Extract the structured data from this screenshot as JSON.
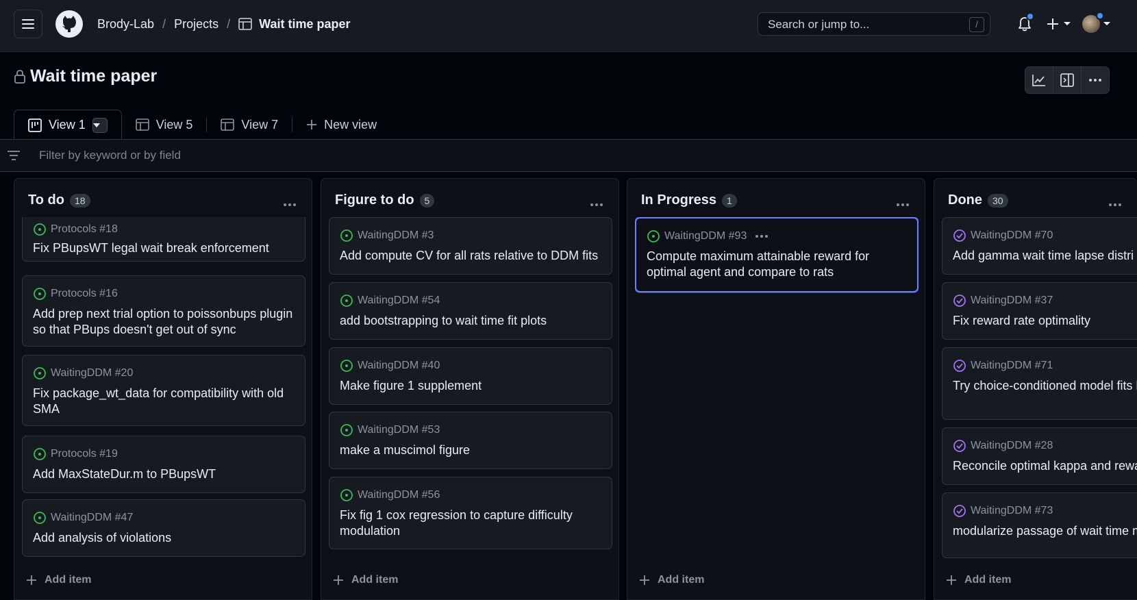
{
  "header": {
    "org": "Brody-Lab",
    "projects": "Projects",
    "project": "Wait time paper",
    "search_placeholder": "Search or jump to...",
    "search_shortcut": "/",
    "icons": [
      "hamburger-icon",
      "github-logo-icon",
      "bell-icon",
      "plus-icon",
      "avatar"
    ]
  },
  "page": {
    "title": "Wait time paper"
  },
  "tabs": [
    {
      "label": "View 1"
    },
    {
      "label": "View 5"
    },
    {
      "label": "View 7"
    },
    {
      "label": "New view"
    }
  ],
  "filter": {
    "placeholder": "Filter by keyword or by field"
  },
  "columns": [
    {
      "name": "To do",
      "count": "18",
      "add_label": "Add item",
      "cards": [
        {
          "meta": "Protocols #18",
          "title": "Fix PBupsWT legal wait break enforcement",
          "state": "open"
        },
        {
          "meta": "Protocols #16",
          "title": "Add prep next trial option to poissonbups plugin so that PBups doesn't get out of sync",
          "state": "open"
        },
        {
          "meta": "WaitingDDM #20",
          "title": "Fix package_wt_data for compatibility with old SMA",
          "state": "open"
        },
        {
          "meta": "Protocols #19",
          "title": "Add MaxStateDur.m to PBupsWT",
          "state": "open"
        },
        {
          "meta": "WaitingDDM #47",
          "title": "Add analysis of violations",
          "state": "open"
        }
      ]
    },
    {
      "name": "Figure to do",
      "count": "5",
      "add_label": "Add item",
      "cards": [
        {
          "meta": "WaitingDDM #3",
          "title": "Add compute CV for all rats relative to DDM fits",
          "state": "open"
        },
        {
          "meta": "WaitingDDM #54",
          "title": "add bootstrapping to wait time fit plots",
          "state": "open"
        },
        {
          "meta": "WaitingDDM #40",
          "title": "Make figure 1 supplement",
          "state": "open"
        },
        {
          "meta": "WaitingDDM #53",
          "title": "make a muscimol figure",
          "state": "open"
        },
        {
          "meta": "WaitingDDM #56",
          "title": "Fix fig 1 cox regression to capture difficulty modulation",
          "state": "open"
        }
      ]
    },
    {
      "name": "In Progress",
      "count": "1",
      "add_label": "Add item",
      "cards": [
        {
          "meta": "WaitingDDM #93",
          "title": "Compute maximum attainable reward for optimal agent and compare to rats",
          "state": "open"
        }
      ]
    },
    {
      "name": "Done",
      "count": "30",
      "add_label": "Add item",
      "cards": [
        {
          "meta": "WaitingDDM #70",
          "title": "Add gamma wait time lapse distri",
          "state": "closed"
        },
        {
          "meta": "WaitingDDM #37",
          "title": "Fix reward rate optimality",
          "state": "closed"
        },
        {
          "meta": "WaitingDDM #71",
          "title": "Try choice-conditioned model fits lapse and wait time lapse",
          "state": "closed"
        },
        {
          "meta": "WaitingDDM #28",
          "title": "Reconcile optimal kappa and rewa",
          "state": "closed"
        },
        {
          "meta": "WaitingDDM #73",
          "title": "modularize passage of wait time m parameters",
          "state": "closed"
        }
      ]
    }
  ],
  "colors": {
    "open": "#3fb950",
    "closed": "#a371f7",
    "accent": "#6e7fff",
    "notification": "#4493f8"
  }
}
